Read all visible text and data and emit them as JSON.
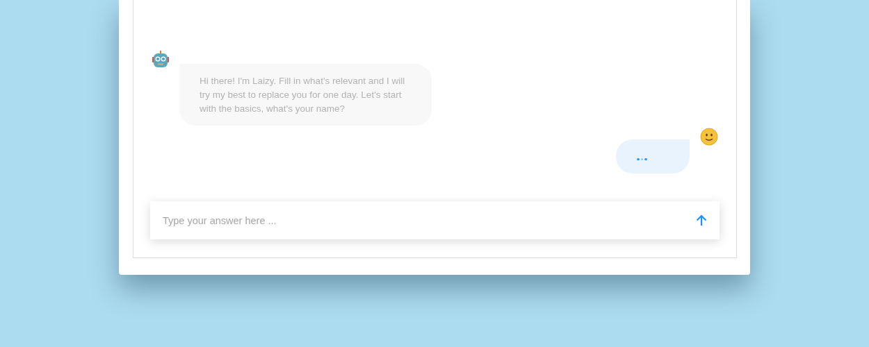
{
  "messages": [
    {
      "kind": "bot",
      "text": "Hi there! I'm Laizy. Fill in what's relevant and I will try my best to replace you for one day. Let's start with the basics, what's your name?"
    },
    {
      "kind": "user-typing"
    }
  ],
  "input": {
    "placeholder": "Type your answer here ..."
  }
}
